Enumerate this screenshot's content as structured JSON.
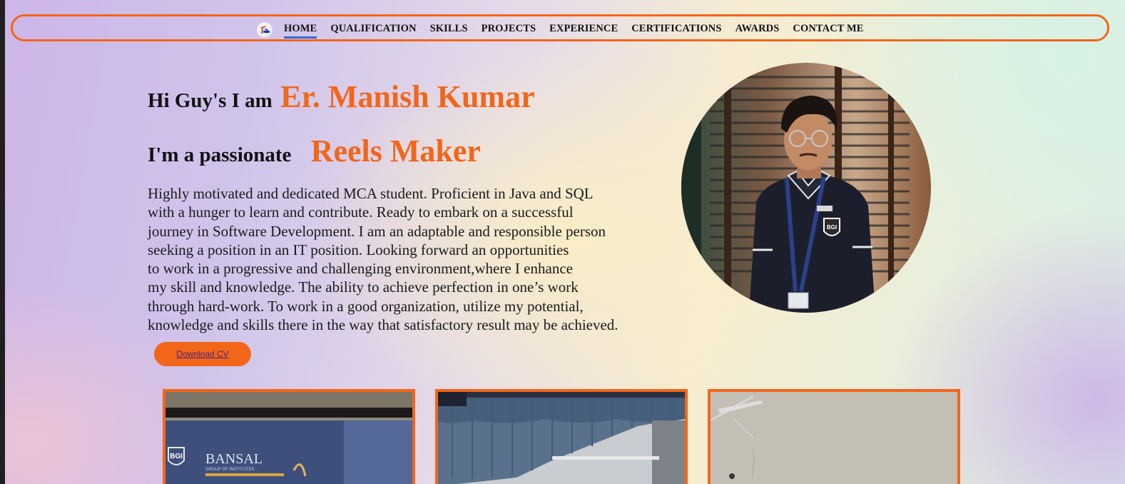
{
  "nav": {
    "logo_icon": "site-logo-icon",
    "links": [
      {
        "label": "HOME",
        "active": true
      },
      {
        "label": "QUALIFICATION",
        "active": false
      },
      {
        "label": "SKILLS",
        "active": false
      },
      {
        "label": "PROJECTS",
        "active": false
      },
      {
        "label": "EXPERIENCE",
        "active": false
      },
      {
        "label": "CERTIFICATIONS",
        "active": false
      },
      {
        "label": "AWARDS",
        "active": false
      },
      {
        "label": "CONTACT ME",
        "active": false
      }
    ]
  },
  "hero": {
    "greeting": "Hi Guy's I am",
    "name": "Er. Manish Kumar",
    "role_prefix": "I'm a passionate",
    "role": "Reels Maker",
    "about_lines": [
      "Highly motivated and dedicated MCA student. Proficient in Java and SQL",
      "with a hunger to learn and contribute. Ready to embark on a successful",
      "journey in Software Development. I am an adaptable and responsible person",
      "seeking a position in an IT position. Looking forward an opportunities",
      "to work in a progressive and challenging environment,where I enhance",
      "my skill and knowledge. The ability to achieve perfection in one’s work",
      "through hard-work. To work in a good organization, utilize my potential,",
      "knowledge and skills there in the way that satisfactory result may be achieved."
    ],
    "cv_button": "Download CV"
  },
  "profile_photo": {
    "badge_text": "BGI"
  },
  "gallery": [
    {
      "logo_text": "BGI",
      "banner_text": "BANSAL",
      "sub_text": "GROUP OF INSTITUTES"
    },
    {},
    {}
  ],
  "colors": {
    "accent": "#f2661a",
    "nav_active_underline": "#2f6be0",
    "text": "#111111",
    "button_text": "#4a1f7a"
  }
}
